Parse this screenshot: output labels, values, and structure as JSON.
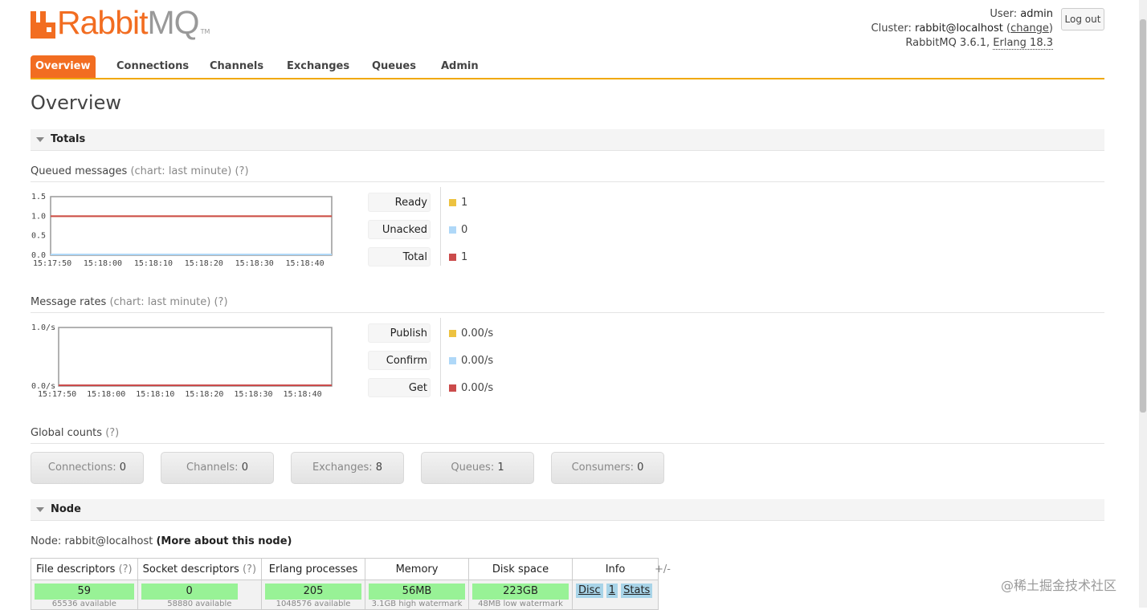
{
  "brand": {
    "rabbit": "Rabbit",
    "mq": "MQ",
    "tm": "TM"
  },
  "user": {
    "user_label": "User:",
    "user_name": "admin",
    "cluster_label": "Cluster:",
    "cluster_name": "rabbit@localhost",
    "change_link": "change",
    "version": "RabbitMQ 3.6.1,",
    "erlang": "Erlang 18.3",
    "logout": "Log out"
  },
  "tabs": [
    "Overview",
    "Connections",
    "Channels",
    "Exchanges",
    "Queues",
    "Admin"
  ],
  "page_title": "Overview",
  "totals": {
    "section_title": "Totals",
    "queued": {
      "title": "Queued messages",
      "note": "(chart: last minute)",
      "help": "(?)",
      "legend": [
        {
          "label": "Ready",
          "value": "1",
          "color": "#edc240"
        },
        {
          "label": "Unacked",
          "value": "0",
          "color": "#afd8f8"
        },
        {
          "label": "Total",
          "value": "1",
          "color": "#cb4b4b"
        }
      ]
    },
    "rates": {
      "title": "Message rates",
      "note": "(chart: last minute)",
      "help": "(?)",
      "legend": [
        {
          "label": "Publish",
          "value": "0.00/s",
          "color": "#edc240"
        },
        {
          "label": "Confirm",
          "value": "0.00/s",
          "color": "#afd8f8"
        },
        {
          "label": "Get",
          "value": "0.00/s",
          "color": "#cb4b4b"
        }
      ]
    },
    "global": {
      "title": "Global counts",
      "help": "(?)",
      "items": [
        {
          "label": "Connections:",
          "value": "0"
        },
        {
          "label": "Channels:",
          "value": "0"
        },
        {
          "label": "Exchanges:",
          "value": "8"
        },
        {
          "label": "Queues:",
          "value": "1"
        },
        {
          "label": "Consumers:",
          "value": "0"
        }
      ]
    }
  },
  "chart_data": [
    {
      "type": "line",
      "x": [
        "15:17:50",
        "15:18:00",
        "15:18:10",
        "15:18:20",
        "15:18:30",
        "15:18:40"
      ],
      "y_ticks": [
        "1.5",
        "1.0",
        "0.5",
        "0.0"
      ],
      "ylim": [
        0,
        1.5
      ],
      "series": [
        {
          "name": "Ready",
          "values": [
            1,
            1,
            1,
            1,
            1,
            1
          ],
          "color": "#edc240"
        },
        {
          "name": "Unacked",
          "values": [
            0,
            0,
            0,
            0,
            0,
            0
          ],
          "color": "#afd8f8"
        },
        {
          "name": "Total",
          "values": [
            1,
            1,
            1,
            1,
            1,
            1
          ],
          "color": "#cb4b4b"
        }
      ]
    },
    {
      "type": "line",
      "x": [
        "15:17:50",
        "15:18:00",
        "15:18:10",
        "15:18:20",
        "15:18:30",
        "15:18:40"
      ],
      "y_ticks": [
        "1.0/s",
        "0.0/s"
      ],
      "ylim": [
        0,
        1.0
      ],
      "series": [
        {
          "name": "Publish",
          "values": [
            0,
            0,
            0,
            0,
            0,
            0
          ],
          "color": "#edc240"
        },
        {
          "name": "Confirm",
          "values": [
            0,
            0,
            0,
            0,
            0,
            0
          ],
          "color": "#afd8f8"
        },
        {
          "name": "Get",
          "values": [
            0,
            0,
            0,
            0,
            0,
            0
          ],
          "color": "#cb4b4b"
        }
      ]
    }
  ],
  "node": {
    "section_title": "Node",
    "label": "Node:",
    "name": "rabbit@localhost",
    "more": "(More about this node)",
    "headers": {
      "fd": "File descriptors",
      "sd": "Socket descriptors",
      "ep": "Erlang processes",
      "mem": "Memory",
      "disk": "Disk space",
      "info": "Info",
      "help": "(?)"
    },
    "values": {
      "fd": "59",
      "fd_sub": "65536 available",
      "sd": "0",
      "sd_sub": "58880 available",
      "ep": "205",
      "ep_sub": "1048576 available",
      "mem": "56MB",
      "mem_sub": "3.1GB high watermark",
      "disk": "223GB",
      "disk_sub": "48MB low watermark",
      "info": [
        "Disc",
        "1",
        "Stats"
      ]
    },
    "plusminus": "+/-"
  },
  "watermark": "@稀土掘金技术社区"
}
